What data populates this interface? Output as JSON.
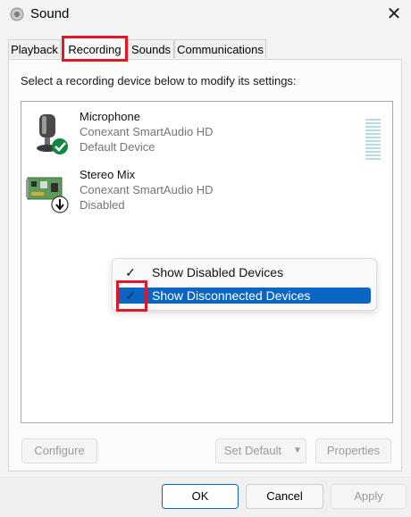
{
  "window": {
    "title": "Sound",
    "close_glyph": "✕"
  },
  "tabs": [
    {
      "label": "Playback"
    },
    {
      "label": "Recording",
      "active": true
    },
    {
      "label": "Sounds"
    },
    {
      "label": "Communications"
    }
  ],
  "instruction": "Select a recording device below to modify its settings:",
  "devices": [
    {
      "name": "Microphone",
      "driver": "Conexant SmartAudio HD",
      "status": "Default Device",
      "icon": "microphone-icon",
      "badge": "default-check-badge"
    },
    {
      "name": "Stereo Mix",
      "driver": "Conexant SmartAudio HD",
      "status": "Disabled",
      "icon": "sound-card-icon",
      "badge": "disabled-arrow-badge"
    }
  ],
  "context_menu": {
    "items": [
      {
        "label": "Show Disabled Devices",
        "checked": true,
        "highlighted": false
      },
      {
        "label": "Show Disconnected Devices",
        "checked": true,
        "highlighted": true
      }
    ]
  },
  "panel_buttons": {
    "configure": "Configure",
    "set_default": "Set Default",
    "properties": "Properties"
  },
  "footer_buttons": {
    "ok": "OK",
    "cancel": "Cancel",
    "apply": "Apply"
  },
  "colors": {
    "highlight": "#0a66c2",
    "annotation_red": "#e01823",
    "level_meter": "#b7dbe7"
  }
}
